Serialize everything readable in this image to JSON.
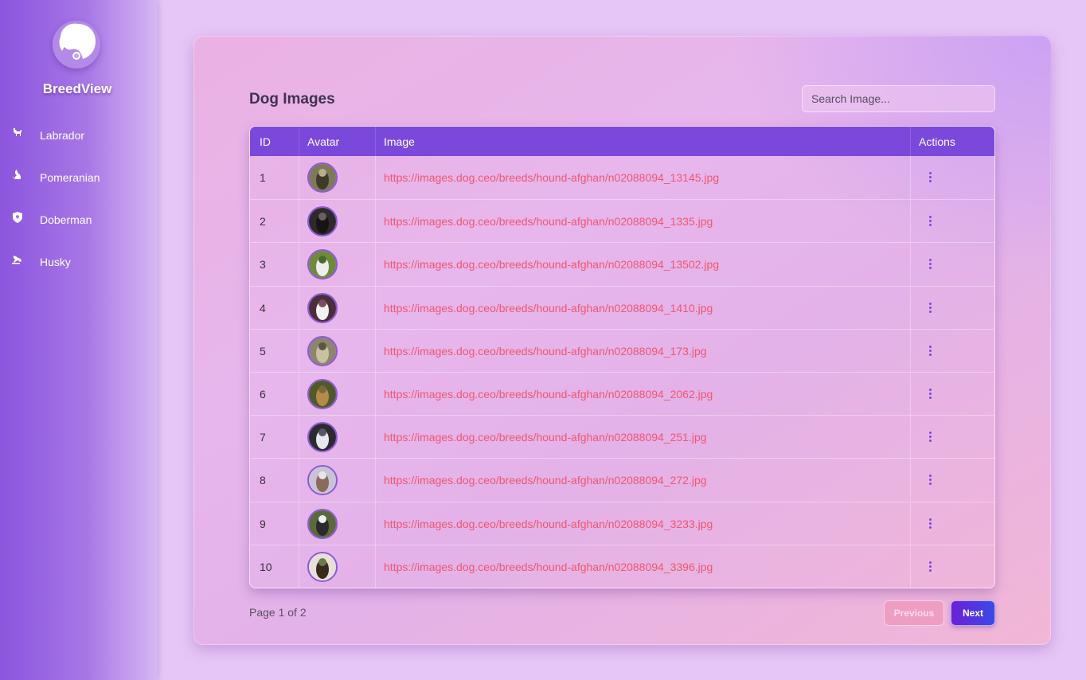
{
  "app": {
    "brand": "BreedView",
    "accent": "#7b48dc",
    "link_color": "#f0566e"
  },
  "sidebar": {
    "items": [
      {
        "label": "Labrador",
        "icon": "dog-icon"
      },
      {
        "label": "Pomeranian",
        "icon": "dog-sitting-icon"
      },
      {
        "label": "Doberman",
        "icon": "shield-dog-icon"
      },
      {
        "label": "Husky",
        "icon": "dog-running-icon"
      }
    ]
  },
  "main": {
    "title": "Dog Images",
    "search_placeholder": "Search Image...",
    "table": {
      "headers": {
        "id": "ID",
        "avatar": "Avatar",
        "image": "Image",
        "actions": "Actions"
      },
      "rows": [
        {
          "id": "1",
          "url": "https://images.dog.ceo/breeds/hound-afghan/n02088094_13145.jpg"
        },
        {
          "id": "2",
          "url": "https://images.dog.ceo/breeds/hound-afghan/n02088094_1335.jpg"
        },
        {
          "id": "3",
          "url": "https://images.dog.ceo/breeds/hound-afghan/n02088094_13502.jpg"
        },
        {
          "id": "4",
          "url": "https://images.dog.ceo/breeds/hound-afghan/n02088094_1410.jpg"
        },
        {
          "id": "5",
          "url": "https://images.dog.ceo/breeds/hound-afghan/n02088094_173.jpg"
        },
        {
          "id": "6",
          "url": "https://images.dog.ceo/breeds/hound-afghan/n02088094_2062.jpg"
        },
        {
          "id": "7",
          "url": "https://images.dog.ceo/breeds/hound-afghan/n02088094_251.jpg"
        },
        {
          "id": "8",
          "url": "https://images.dog.ceo/breeds/hound-afghan/n02088094_272.jpg"
        },
        {
          "id": "9",
          "url": "https://images.dog.ceo/breeds/hound-afghan/n02088094_3233.jpg"
        },
        {
          "id": "10",
          "url": "https://images.dog.ceo/breeds/hound-afghan/n02088094_3396.jpg"
        }
      ]
    },
    "pagination": {
      "info": "Page 1 of 2",
      "previous_label": "Previous",
      "next_label": "Next"
    }
  }
}
